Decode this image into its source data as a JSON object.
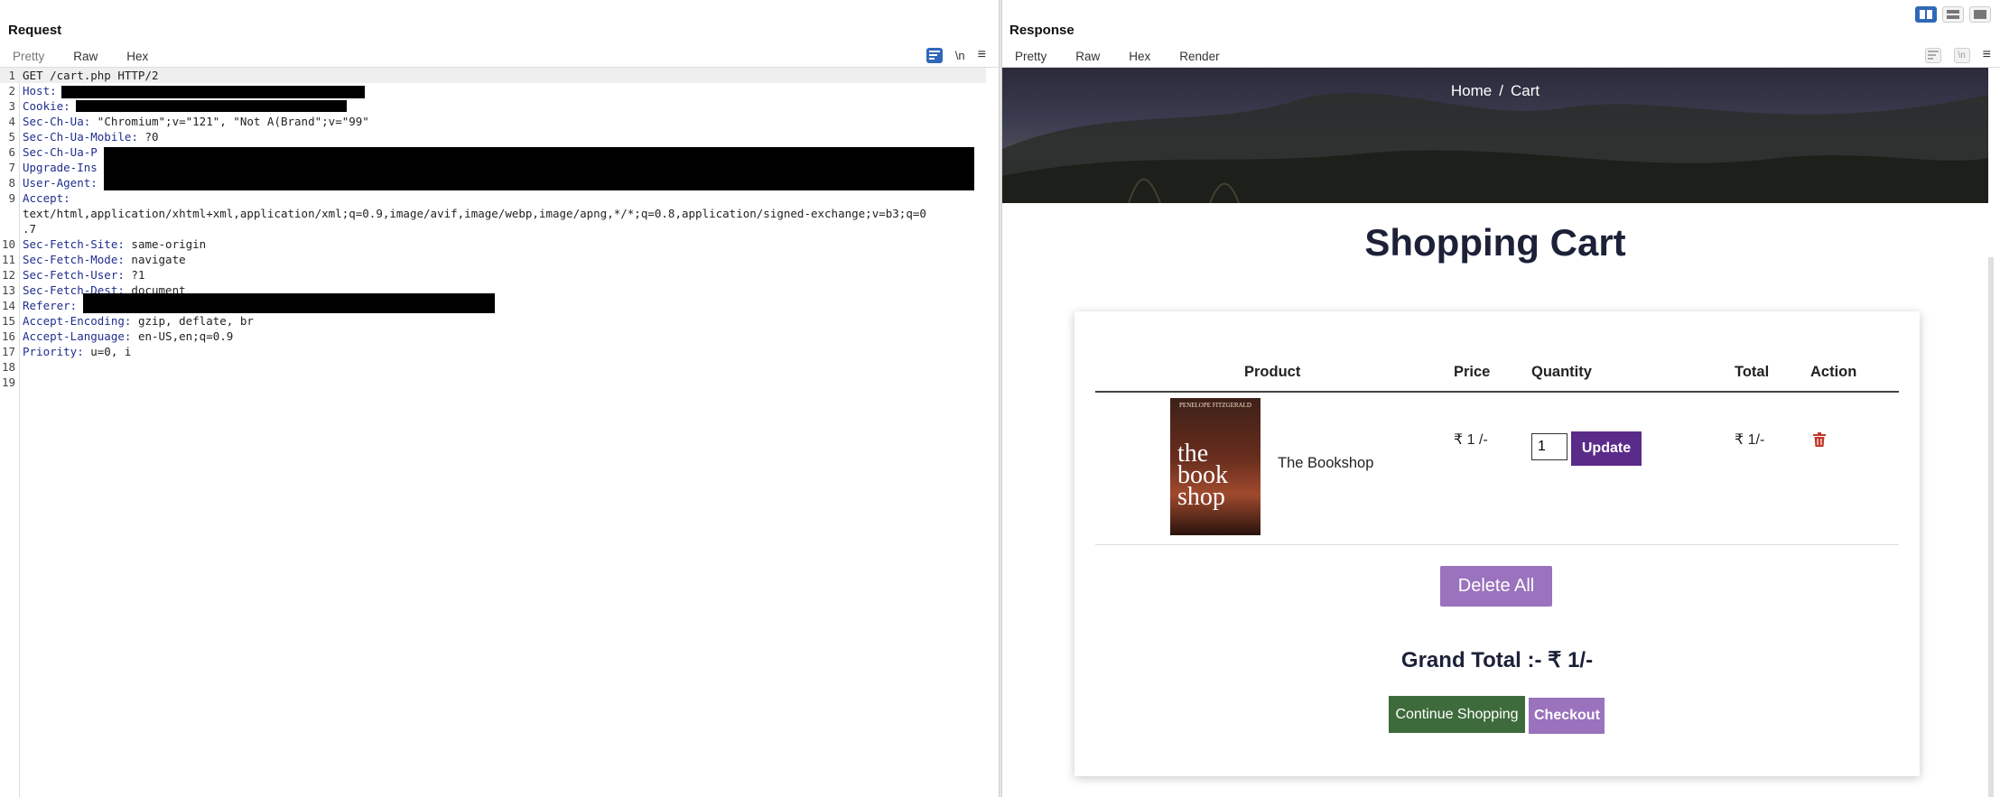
{
  "request": {
    "title": "Request",
    "tabs": [
      "Pretty",
      "Raw",
      "Hex"
    ],
    "newline_label": "\\n",
    "menu_glyph": "≡",
    "lines": [
      {
        "num": "1",
        "name": "",
        "value": "GET /cart.php HTTP/2"
      },
      {
        "num": "2",
        "name": "Host:",
        "value": ""
      },
      {
        "num": "3",
        "name": "Cookie:",
        "value": ""
      },
      {
        "num": "4",
        "name": "Sec-Ch-Ua:",
        "value": " \"Chromium\";v=\"121\", \"Not A(Brand\";v=\"99\""
      },
      {
        "num": "5",
        "name": "Sec-Ch-Ua-Mobile:",
        "value": " ?0"
      },
      {
        "num": "6",
        "name": "Sec-Ch-Ua-P",
        "value": ""
      },
      {
        "num": "7",
        "name": "Upgrade-Ins",
        "value": ""
      },
      {
        "num": "8",
        "name": "User-Agent:",
        "value": ""
      },
      {
        "num": "9",
        "name": "Accept:",
        "value": ""
      },
      {
        "num": "",
        "name": "",
        "value": "text/html,application/xhtml+xml,application/xml;q=0.9,image/avif,image/webp,image/apng,*/*;q=0.8,application/signed-exchange;v=b3;q=0"
      },
      {
        "num": "",
        "name": "",
        "value": ".7"
      },
      {
        "num": "10",
        "name": "Sec-Fetch-Site:",
        "value": " same-origin"
      },
      {
        "num": "11",
        "name": "Sec-Fetch-Mode:",
        "value": " navigate"
      },
      {
        "num": "12",
        "name": "Sec-Fetch-User:",
        "value": " ?1"
      },
      {
        "num": "13",
        "name": "Sec-Fetch-Dest:",
        "value": " document"
      },
      {
        "num": "14",
        "name": "Referer:",
        "value": ""
      },
      {
        "num": "15",
        "name": "Accept-Encoding:",
        "value": " gzip, deflate, br"
      },
      {
        "num": "16",
        "name": "Accept-Language:",
        "value": " en-US,en;q=0.9"
      },
      {
        "num": "17",
        "name": "Priority:",
        "value": " u=0, i"
      },
      {
        "num": "18",
        "name": "",
        "value": ""
      },
      {
        "num": "19",
        "name": "",
        "value": ""
      }
    ]
  },
  "response": {
    "title": "Response",
    "tabs": [
      "Pretty",
      "Raw",
      "Hex",
      "Render"
    ],
    "newline_label": "\\n",
    "menu_glyph": "≡"
  },
  "page": {
    "breadcrumb": {
      "home": "Home",
      "sep": "/",
      "current": "Cart"
    },
    "title": "Shopping Cart",
    "table": {
      "headers": {
        "product": "Product",
        "price": "Price",
        "quantity": "Quantity",
        "total": "Total",
        "action": "Action"
      },
      "row": {
        "book_author": "PENELOPE FITZGERALD",
        "book_title_1": "the book",
        "book_title_2": "shop",
        "product": "The Bookshop",
        "price": "₹ 1 /-",
        "quantity": "1",
        "update_label": "Update",
        "total": "₹ 1/-"
      }
    },
    "delete_all_label": "Delete All",
    "grand_total": "Grand Total :- ₹ 1/-",
    "continue_label": "Continue Shopping",
    "checkout_label": "Checkout"
  },
  "colors": {
    "accent_tab": "#e07a3a",
    "brand_purple": "#5b2b8a",
    "light_purple": "#9a72bd",
    "green": "#3e6b3c",
    "trash_red": "#c0392b"
  }
}
